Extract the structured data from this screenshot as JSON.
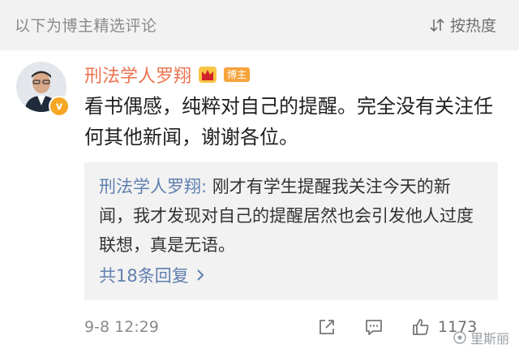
{
  "header": {
    "section_title": "以下为博主精选评论",
    "sort_label": "按热度"
  },
  "comment": {
    "username": "刑法学人罗翔",
    "badge_label": "博主",
    "verified_badge": "v",
    "text": "看书偶感，纯粹对自己的提醒。完全没有关注任何其他新闻，谢谢各位。",
    "reply": {
      "author": "刑法学人罗翔:",
      "text": " 刚才有学生提醒我关注今天的新闻，我才发现对自己的提醒居然也会引发他人过度联想，真是无语。",
      "replies_link": "共18条回复"
    },
    "timestamp": "9-8 12:29",
    "like_count": "1173"
  },
  "watermark": "里斯丽",
  "icons": {
    "sort": "sort-icon",
    "crown": "crown-icon",
    "share": "share-icon",
    "comment": "comment-icon",
    "like": "thumbs-up-icon",
    "reply_arrow": "chevron-right-icon"
  },
  "colors": {
    "username": "#eb7350",
    "link": "#5f7fb0",
    "badge": "#f6a33c",
    "verified": "#f5a623"
  }
}
